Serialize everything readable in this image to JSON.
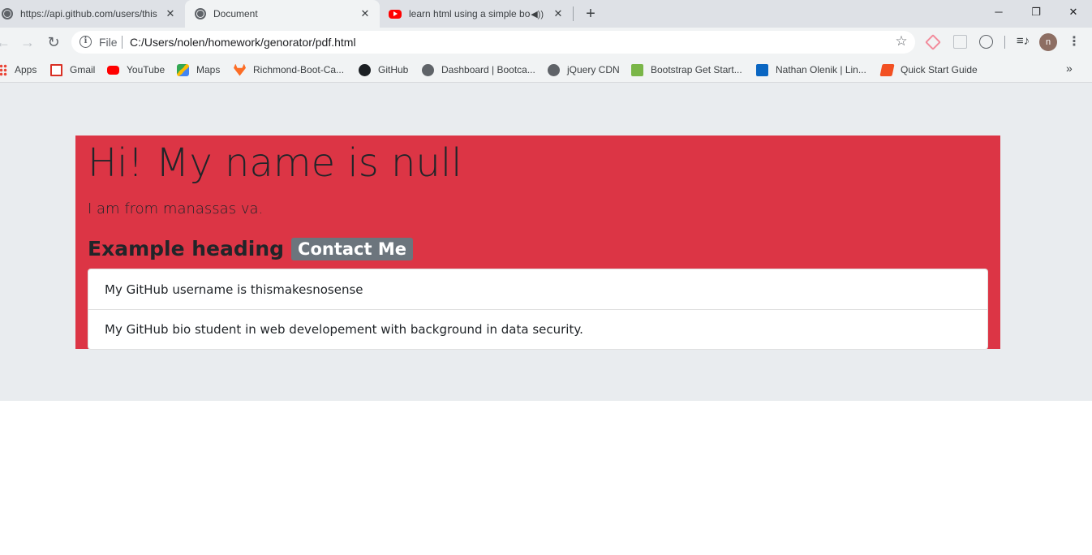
{
  "browser": {
    "tabs": [
      {
        "title": "https://api.github.com/users/this",
        "favicon": "globe-icon",
        "active": false
      },
      {
        "title": "Document",
        "favicon": "globe-icon",
        "active": true
      },
      {
        "title": "learn html using a simple boo",
        "favicon": "youtube-icon",
        "active": false,
        "audio": true
      }
    ],
    "close_glyph": "✕",
    "new_tab_glyph": "+",
    "window_controls": {
      "minimize": "─",
      "restore": "❐",
      "close": "✕"
    },
    "nav": {
      "back": "←",
      "forward": "→",
      "reload": "↻"
    },
    "omnibox": {
      "info_glyph": "i",
      "scheme_label": "File",
      "url": "C:/Users/nolen/homework/genorator/pdf.html"
    },
    "star_glyph": "☆",
    "media_glyph": "≡♪",
    "profile_initial": "n",
    "menu_glyph": "⋮",
    "bookmarks": [
      {
        "label": "Apps",
        "icon": "apps-icon"
      },
      {
        "label": "Gmail",
        "icon": "gmail-icon"
      },
      {
        "label": "YouTube",
        "icon": "youtube-icon"
      },
      {
        "label": "Maps",
        "icon": "maps-icon"
      },
      {
        "label": "Richmond-Boot-Ca...",
        "icon": "gitlab-icon"
      },
      {
        "label": "GitHub",
        "icon": "github-icon"
      },
      {
        "label": "Dashboard | Bootca...",
        "icon": "globe-icon"
      },
      {
        "label": "jQuery CDN",
        "icon": "globe-icon"
      },
      {
        "label": "Bootstrap Get Start...",
        "icon": "bootstrap-icon"
      },
      {
        "label": "Nathan Olenik | Lin...",
        "icon": "linkedin-icon"
      },
      {
        "label": "Quick Start Guide",
        "icon": "quickstart-icon"
      }
    ],
    "bookmarks_more": "»"
  },
  "page": {
    "heading": "Hi! My name is null",
    "lead": "I am from manassas va.",
    "subheading": "Example heading",
    "contact_badge": "Contact Me",
    "list_items": [
      "My GitHub username is thismakesnosense",
      "My GitHub bio student in web developement with background in data security."
    ],
    "colors": {
      "jumbotron": "#dc3545",
      "page_background": "#e9ecef",
      "badge": "#6c757d"
    }
  }
}
